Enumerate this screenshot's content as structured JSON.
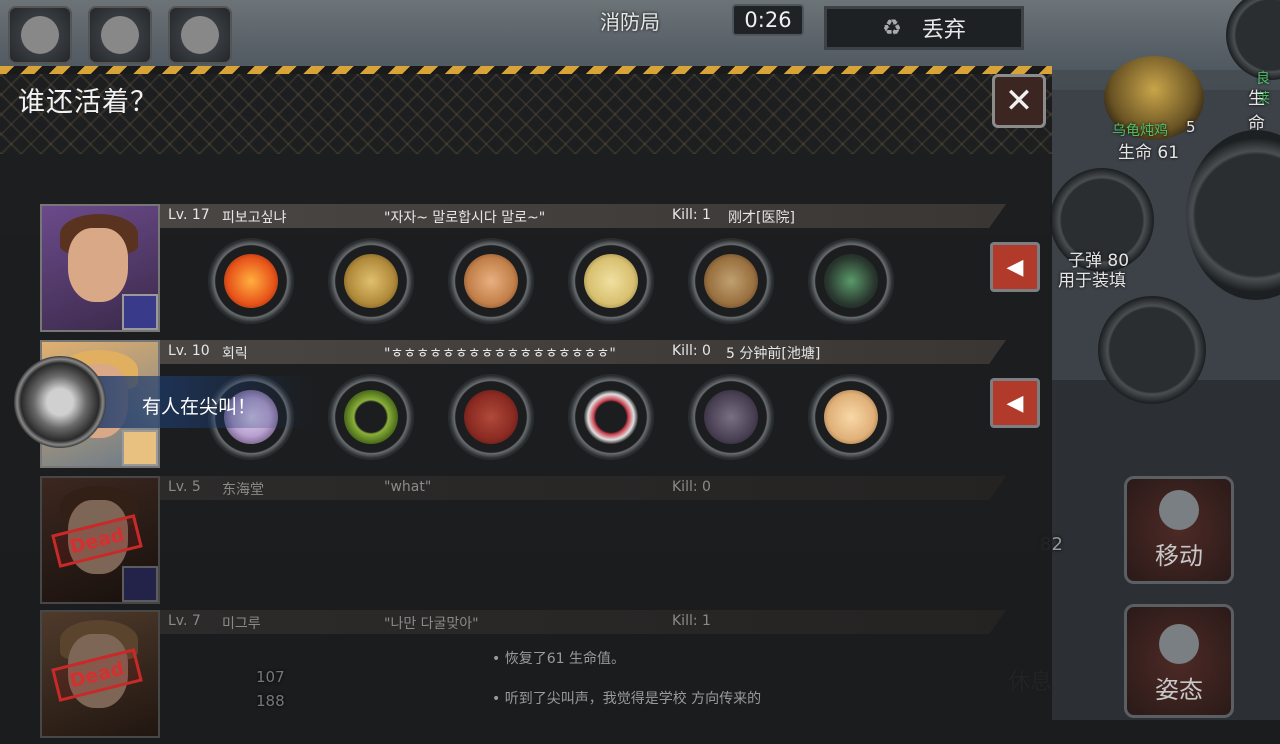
{
  "top": {
    "location": "消防局",
    "timer": "0:26",
    "discard_label": "丢弃",
    "hud_buttons": [
      {
        "icon": "face-icon"
      },
      {
        "icon": "chat-bubble-icon"
      },
      {
        "icon": "users-icon"
      }
    ]
  },
  "right": {
    "top_label": "良莱",
    "top_sub": "生命",
    "food_name": "乌龟炖鸡",
    "food_count": "5",
    "food_life": "生命 61",
    "ammo_name": "子弹 80",
    "ammo_use": "用于装填",
    "move_label": "移动",
    "rest_label": "休息",
    "stance_label": "姿态",
    "side_count": "82"
  },
  "panel": {
    "title": "谁还活着？",
    "close_label": "✕"
  },
  "players": [
    {
      "level": "Lv. 17",
      "name": "피보고싶냐",
      "quote": "\"자자~ 말로합시다 말로~\"",
      "kill": "Kill: 1",
      "last_seen": "刚才[医院]",
      "dead": false,
      "items": [
        {
          "name": "fire-hand-item",
          "color": "#e8541a"
        },
        {
          "name": "golden-helmet-item",
          "color": "#b08a3a"
        },
        {
          "name": "rope-gauntlet-item",
          "color": "#c2804a"
        },
        {
          "name": "shield-item",
          "color": "#d8c070"
        },
        {
          "name": "gauntlet-item",
          "color": "#9a7040"
        },
        {
          "name": "scope-item",
          "color": "#3a6a4a"
        }
      ]
    },
    {
      "level": "Lv. 10",
      "name": "회릭",
      "quote": "\"ㅎㅎㅎㅎㅎㅎㅎㅎㅎㅎㅎㅎㅎㅎㅎㅎㅎ\"",
      "kill": "Kill: 0",
      "last_seen": "5 分钟前[池塘]",
      "dead": false,
      "items": [
        {
          "name": "sword-item",
          "color": "#b8a0d0"
        },
        {
          "name": "laurel-wreath-item",
          "color": "#8ab03a"
        },
        {
          "name": "red-armor-item",
          "color": "#8a2a22"
        },
        {
          "name": "bead-bracelet-item",
          "color": "#c83a4a"
        },
        {
          "name": "dark-gauntlet-item",
          "color": "#4a4054"
        },
        {
          "name": "fan-item",
          "color": "#e0b078"
        }
      ]
    },
    {
      "level": "Lv. 5",
      "name": "东海堂",
      "quote": "\"what\"",
      "kill": "Kill: 0",
      "last_seen": "",
      "dead": true,
      "items": []
    },
    {
      "level": "Lv. 7",
      "name": "미그루",
      "quote": "\"나만 다굴맞아\"",
      "kill": "Kill: 1",
      "last_seen": "",
      "dead": true,
      "items": []
    }
  ],
  "dead_label": "Dead",
  "toast": {
    "message": "有人在尖叫！"
  },
  "log": [
    "• 恢复了61 生命值。",
    "• 听到了尖叫声，我觉得是学校 方向传来的"
  ],
  "status": {
    "left_a": "107",
    "left_b": "188"
  }
}
